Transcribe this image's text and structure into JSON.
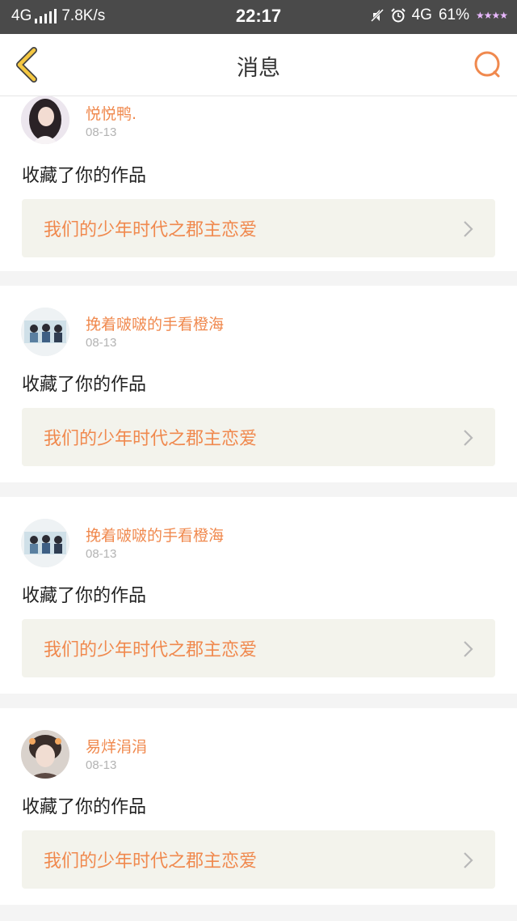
{
  "status_bar": {
    "network_left": "4G",
    "speed": "7.8K/s",
    "time": "22:17",
    "network_right": "4G",
    "battery": "61%",
    "decoration": "★★★★"
  },
  "nav": {
    "title": "消息",
    "back_icon": "chevron-left-icon",
    "search_icon": "search-icon"
  },
  "colors": {
    "accent": "#f0894e",
    "back_icon": "#f5c842",
    "work_bg": "#f3f3ec"
  },
  "notifications": [
    {
      "user": "悦悦鸭.",
      "date": "08-13",
      "action": "收藏了你的作品",
      "work_title": "我们的少年时代之郡主恋爱"
    },
    {
      "user": "挽着啵啵的手看橙海",
      "date": "08-13",
      "action": "收藏了你的作品",
      "work_title": "我们的少年时代之郡主恋爱"
    },
    {
      "user": "挽着啵啵的手看橙海",
      "date": "08-13",
      "action": "收藏了你的作品",
      "work_title": "我们的少年时代之郡主恋爱"
    },
    {
      "user": "易烊涓涓",
      "date": "08-13",
      "action": "收藏了你的作品",
      "work_title": "我们的少年时代之郡主恋爱"
    }
  ]
}
